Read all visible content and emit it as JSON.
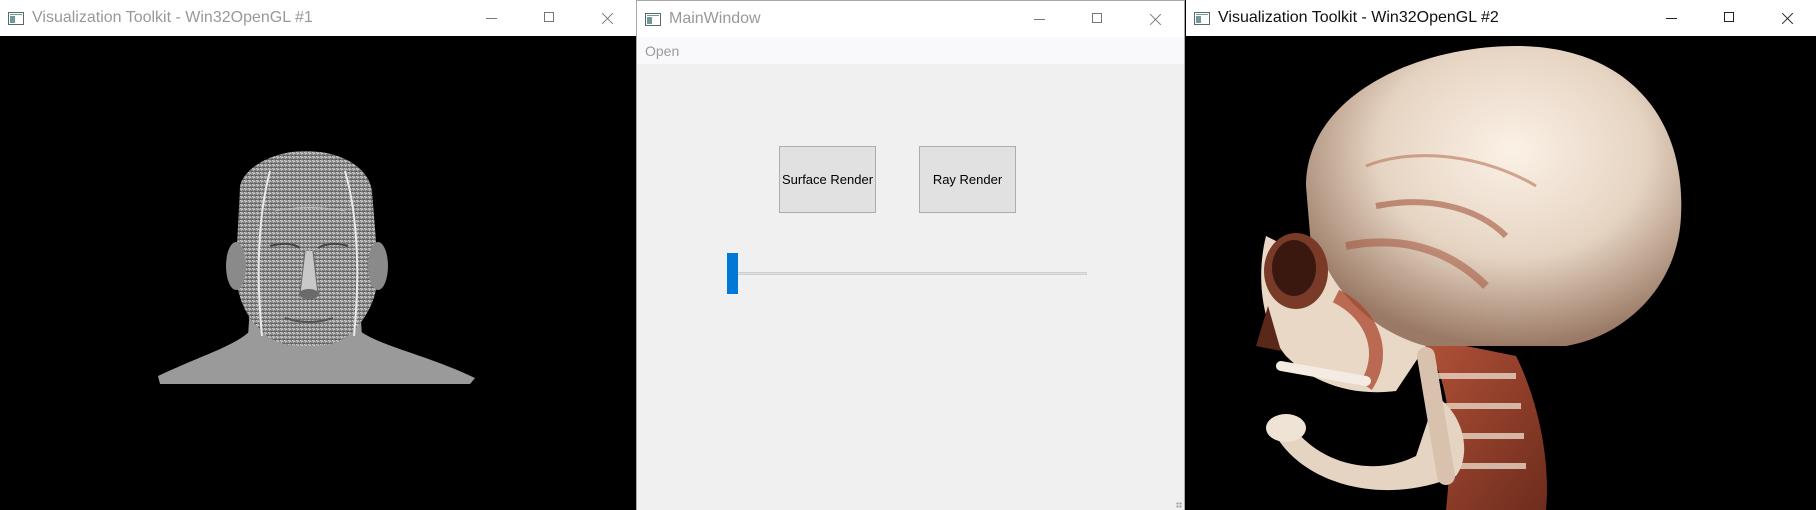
{
  "windows": {
    "left": {
      "title": "Visualization Toolkit - Win32OpenGL #1",
      "render_subject": "surface-rendered head (white isosurface on black)"
    },
    "middle": {
      "title": "MainWindow",
      "menu": [
        "Open"
      ],
      "buttons": {
        "surface": "Surface Render",
        "ray": "Ray Render"
      },
      "slider": {
        "value": 0,
        "accent": "#0078d7"
      }
    },
    "right": {
      "title": "Visualization Toolkit - Win32OpenGL #2",
      "render_subject": "volume ray-cast skull (bone and tissue colored)"
    }
  },
  "colors": {
    "accent": "#0078d7",
    "render_bg": "#000000",
    "bone": "#eee0d2",
    "tissue": "#9a4a34"
  },
  "icons": {
    "app": "vtk-window-icon",
    "minimize": "minimize-icon",
    "maximize": "maximize-icon",
    "close": "close-icon"
  }
}
